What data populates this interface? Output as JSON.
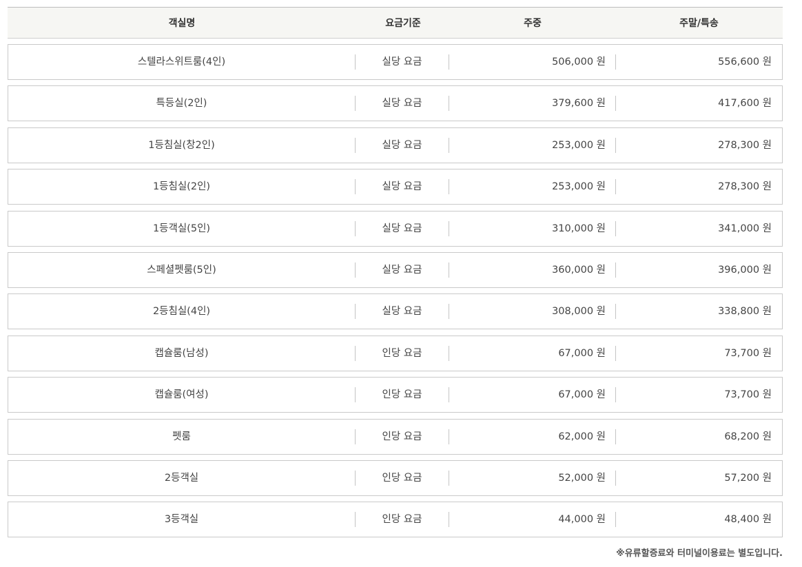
{
  "table": {
    "headers": {
      "name": "객실명",
      "basis": "요금기준",
      "weekday": "주중",
      "weekend": "주말/특송"
    },
    "rows": [
      {
        "name": "스텔라스위트룸(4인)",
        "basis": "실당 요금",
        "weekday": "506,000 원",
        "weekend": "556,600 원"
      },
      {
        "name": "특등실(2인)",
        "basis": "실당 요금",
        "weekday": "379,600 원",
        "weekend": "417,600 원"
      },
      {
        "name": "1등침실(창2인)",
        "basis": "실당 요금",
        "weekday": "253,000 원",
        "weekend": "278,300 원"
      },
      {
        "name": "1등침실(2인)",
        "basis": "실당 요금",
        "weekday": "253,000 원",
        "weekend": "278,300 원"
      },
      {
        "name": "1등객실(5인)",
        "basis": "실당 요금",
        "weekday": "310,000 원",
        "weekend": "341,000 원"
      },
      {
        "name": "스페셜펫룸(5인)",
        "basis": "실당 요금",
        "weekday": "360,000 원",
        "weekend": "396,000 원"
      },
      {
        "name": "2등침실(4인)",
        "basis": "실당 요금",
        "weekday": "308,000 원",
        "weekend": "338,800 원"
      },
      {
        "name": "캡슐룸(남성)",
        "basis": "인당 요금",
        "weekday": "67,000 원",
        "weekend": "73,700 원"
      },
      {
        "name": "캡슐룸(여성)",
        "basis": "인당 요금",
        "weekday": "67,000 원",
        "weekend": "73,700 원"
      },
      {
        "name": "펫룸",
        "basis": "인당 요금",
        "weekday": "62,000 원",
        "weekend": "68,200 원"
      },
      {
        "name": "2등객실",
        "basis": "인당 요금",
        "weekday": "52,000 원",
        "weekend": "57,200 원"
      },
      {
        "name": "3등객실",
        "basis": "인당 요금",
        "weekday": "44,000 원",
        "weekend": "48,400 원"
      }
    ]
  },
  "note": "※유류할증료와 터미널이용료는 별도입니다."
}
